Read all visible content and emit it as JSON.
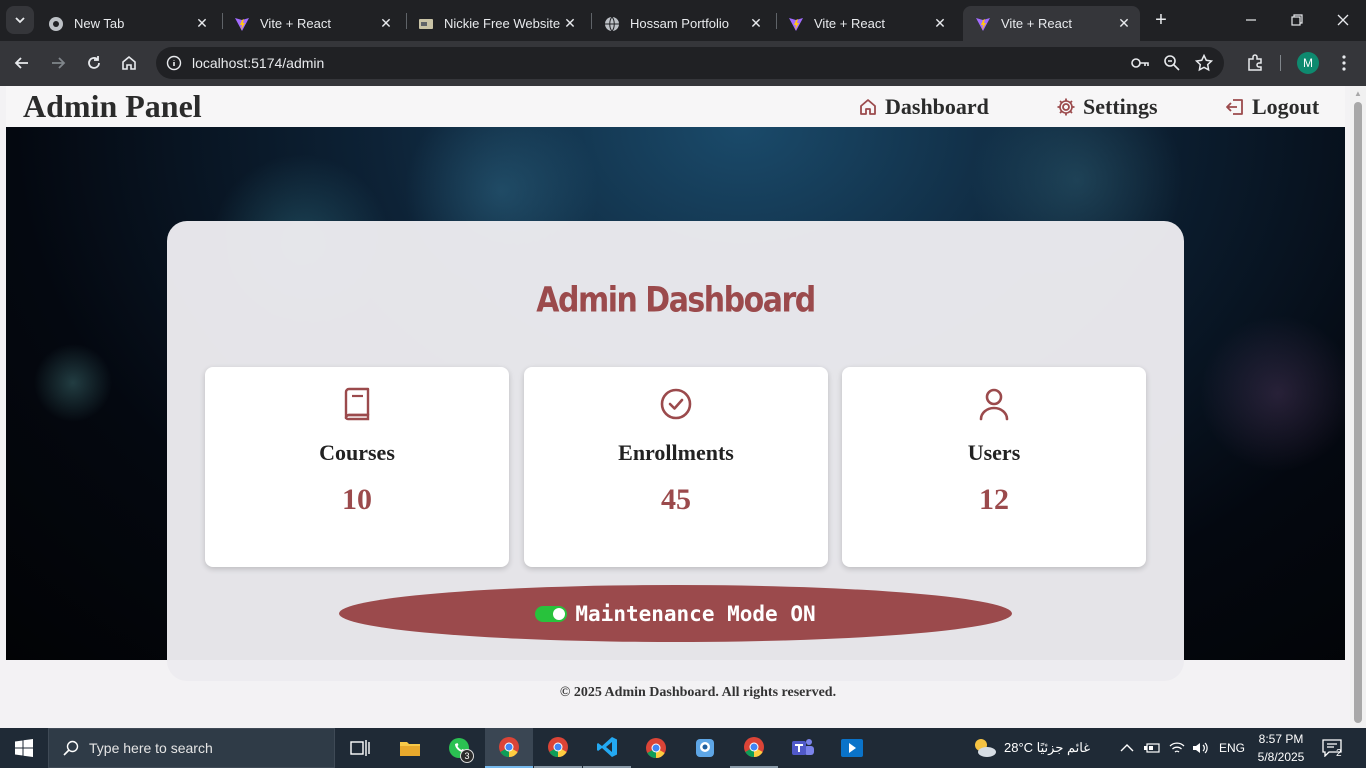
{
  "browser": {
    "tabs": [
      {
        "label": "New Tab",
        "icon": "chrome-icon",
        "active": false
      },
      {
        "label": "Vite + React",
        "icon": "vite-icon",
        "active": false
      },
      {
        "label": "Nickie Free Website T",
        "icon": "website-icon",
        "active": false
      },
      {
        "label": "Hossam Portfolio",
        "icon": "globe-icon",
        "active": false
      },
      {
        "label": "Vite + React",
        "icon": "vite-icon",
        "active": false
      },
      {
        "label": "Vite + React",
        "icon": "vite-icon",
        "active": true
      }
    ],
    "url": "localhost:5174/admin",
    "profile_initial": "M"
  },
  "navbar": {
    "brand": "Admin Panel",
    "links": [
      {
        "label": "Dashboard",
        "icon": "home-icon"
      },
      {
        "label": "Settings",
        "icon": "gear-icon"
      },
      {
        "label": "Logout",
        "icon": "logout-icon"
      }
    ]
  },
  "dashboard": {
    "title": "Admin Dashboard",
    "cards": [
      {
        "label": "Courses",
        "value": "10",
        "icon": "book-icon"
      },
      {
        "label": "Enrollments",
        "value": "45",
        "icon": "check-circle-icon"
      },
      {
        "label": "Users",
        "value": "12",
        "icon": "user-icon"
      }
    ],
    "maintenance_label": "Maintenance Mode ON",
    "maintenance_on": true,
    "accent": "#9b4a4c"
  },
  "footer": {
    "text": "© 2025 Admin Dashboard. All rights reserved."
  },
  "taskbar": {
    "search_placeholder": "Type here to search",
    "whatsapp_badge": "3",
    "weather": "28°C  غائم جزئيًا",
    "language": "ENG",
    "time": "8:57 PM",
    "date": "5/8/2025",
    "notifications": "2"
  }
}
